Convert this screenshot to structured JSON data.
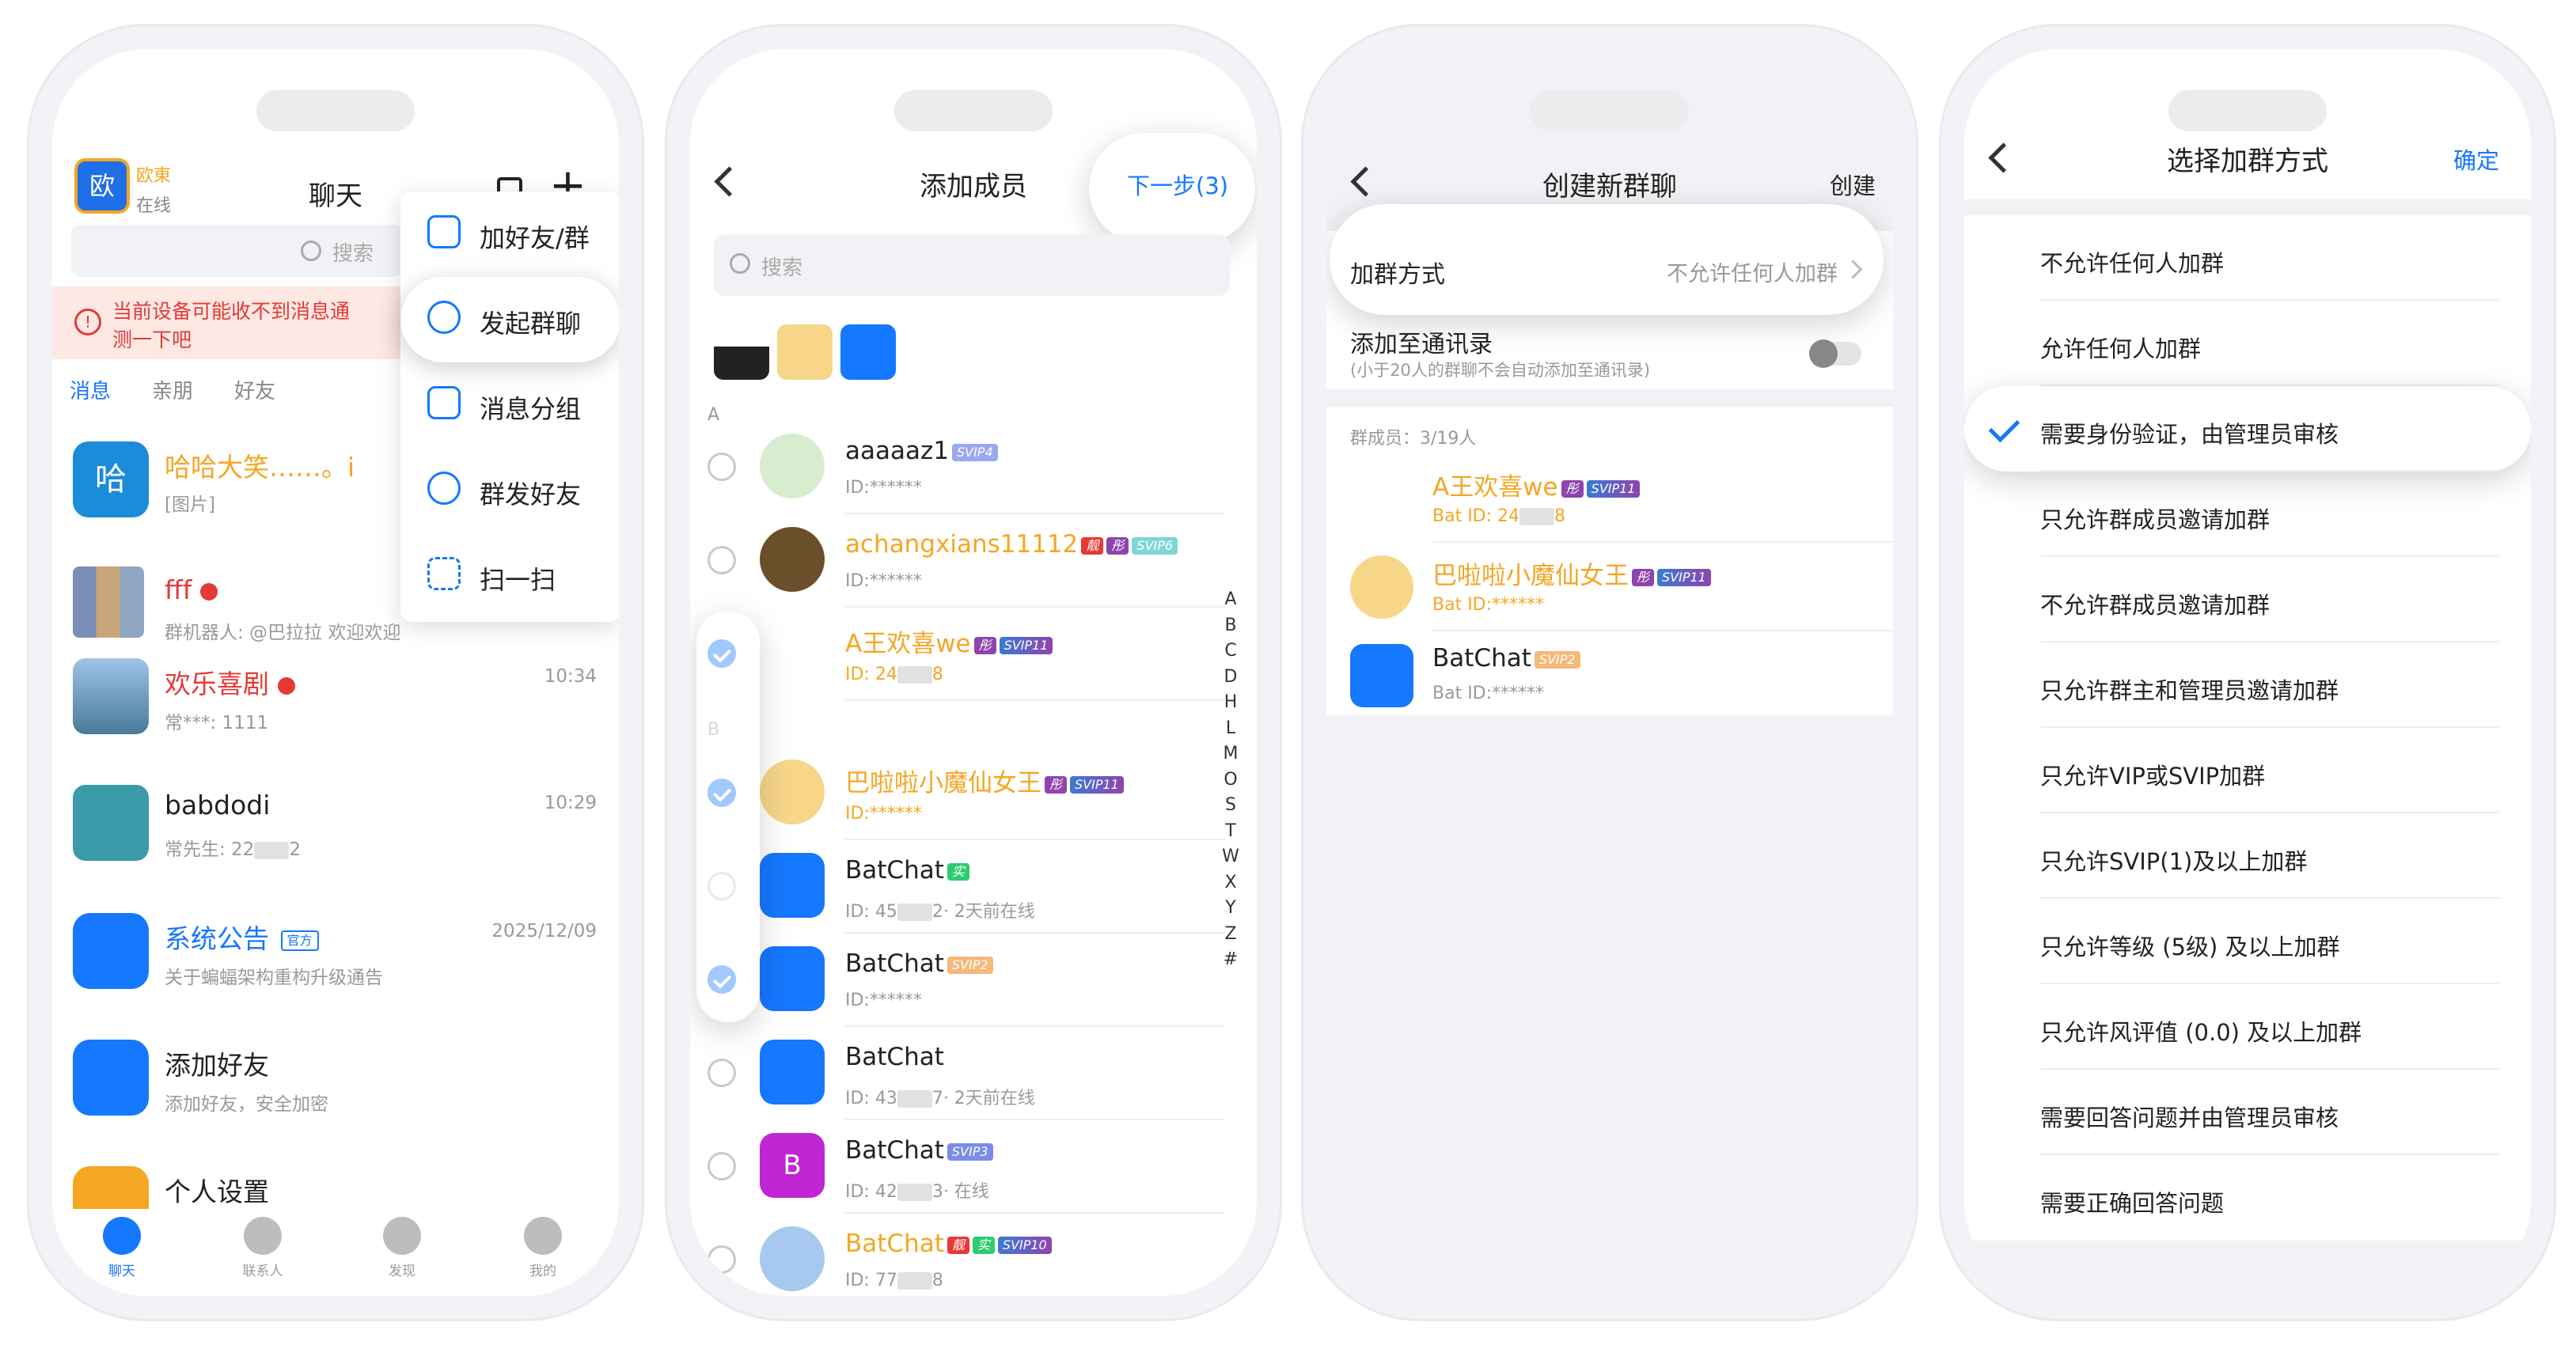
{
  "screen1": {
    "user_name": "欧東",
    "user_status": "在线",
    "avatar_text": "欧",
    "title": "聊天",
    "search_placeholder": "搜索",
    "warning": "当前设备可能收不到消息通",
    "warning2": "测一下吧",
    "tabs": [
      "消息",
      "亲朋",
      "好友"
    ],
    "chats": [
      {
        "name": "哈哈大笑……。i",
        "preview": "[图片]",
        "avatar_text": "哈",
        "time": ""
      },
      {
        "name": "fff",
        "preview": "群机器人: @巴拉拉 欢迎欢迎",
        "time": ""
      },
      {
        "name": "欢乐喜剧",
        "preview": "常***: 1111",
        "time": "10:34"
      },
      {
        "name": "babdodi",
        "preview": "常先生: 22",
        "preview_tail": "2",
        "time": "10:29"
      },
      {
        "name": "系统公告",
        "badge": "官方",
        "preview": "关于蝙蝠架构重构升级通告",
        "time": "2025/12/09"
      },
      {
        "name": "添加好友",
        "preview": "添加好友，安全加密",
        "time": ""
      },
      {
        "name": "个人设置",
        "preview": "",
        "time": ""
      }
    ],
    "menu": [
      "加好友/群",
      "发起群聊",
      "消息分组",
      "群发好友",
      "扫一扫"
    ],
    "tabbar": [
      "聊天",
      "联系人",
      "发现",
      "我的"
    ]
  },
  "screen2": {
    "title": "添加成员",
    "next": "下一步(3)",
    "search_placeholder": "搜索",
    "section_a": "A",
    "section_b": "B",
    "members": [
      {
        "name": "aaaaaz1",
        "tags": [
          "SVIP4"
        ],
        "sub": "ID:******",
        "checked": false
      },
      {
        "name": "achangxians11112",
        "tags": [
          "靓",
          "彤",
          "SVIP6"
        ],
        "sub": "ID:******",
        "checked": false
      },
      {
        "name": "A王欢喜we",
        "tags": [
          "彤",
          "SVIP11"
        ],
        "sub": "ID: 24",
        "sub_tail": "8",
        "checked": true
      },
      {
        "name": "巴啦啦小魔仙女王",
        "tags": [
          "彤",
          "SVIP11"
        ],
        "sub": "ID:******",
        "checked": true
      },
      {
        "name": "BatChat",
        "tags": [
          "实"
        ],
        "sub": "ID: 45",
        "sub_tail": "2· 2天前在线",
        "checked": false
      },
      {
        "name": "BatChat",
        "tags": [
          "SVIP2"
        ],
        "sub": "ID:******",
        "checked": true
      },
      {
        "name": "BatChat",
        "tags": [],
        "sub": "ID: 43",
        "sub_tail": "7· 2天前在线",
        "checked": false
      },
      {
        "name": "BatChat",
        "tags": [
          "SVIP3"
        ],
        "sub": "ID: 42",
        "sub_tail": "3· 在线",
        "checked": false
      },
      {
        "name": "BatChat",
        "tags": [
          "靓",
          "实",
          "SVIP10"
        ],
        "sub": "ID: 77",
        "sub_tail": "8",
        "checked": false
      }
    ],
    "purple_avatar_letter": "B",
    "index_letters": [
      "A",
      "B",
      "C",
      "D",
      "H",
      "L",
      "M",
      "O",
      "S",
      "T",
      "W",
      "X",
      "Y",
      "Z",
      "#"
    ]
  },
  "screen3": {
    "title": "创建新群聊",
    "create": "创建",
    "join_method_label": "加群方式",
    "join_method_value": "不允许任何人加群",
    "add_contacts_label": "添加至通讯录",
    "add_contacts_note": "(小于20人的群聊不会自动添加至通讯录)",
    "members_count": "群成员：3/19人",
    "members": [
      {
        "name": "A王欢喜we",
        "tags": [
          "彤",
          "SVIP11"
        ],
        "sub": "Bat ID: 24",
        "sub_tail": "8"
      },
      {
        "name": "巴啦啦小魔仙女王",
        "tags": [
          "彤",
          "SVIP11"
        ],
        "sub": "Bat ID:******"
      },
      {
        "name": "BatChat",
        "tags": [
          "SVIP2"
        ],
        "sub": "Bat ID:******"
      }
    ]
  },
  "screen4": {
    "title": "选择加群方式",
    "confirm": "确定",
    "options": [
      "不允许任何人加群",
      "允许任何人加群",
      "需要身份验证，由管理员审核",
      "只允许群成员邀请加群",
      "不允许群成员邀请加群",
      "只允许群主和管理员邀请加群",
      "只允许VIP或SVIP加群",
      "只允许SVIP(1)及以上加群",
      "只允许等级 (5级) 及以上加群",
      "只允许风评值 (0.0) 及以上加群",
      "需要回答问题并由管理员审核",
      "需要正确回答问题"
    ],
    "selected_index": 2
  },
  "colors": {
    "accent": "#1677ff",
    "orange": "#f5a623",
    "red": "#e53935",
    "warning_bg": "#fde8e4"
  }
}
